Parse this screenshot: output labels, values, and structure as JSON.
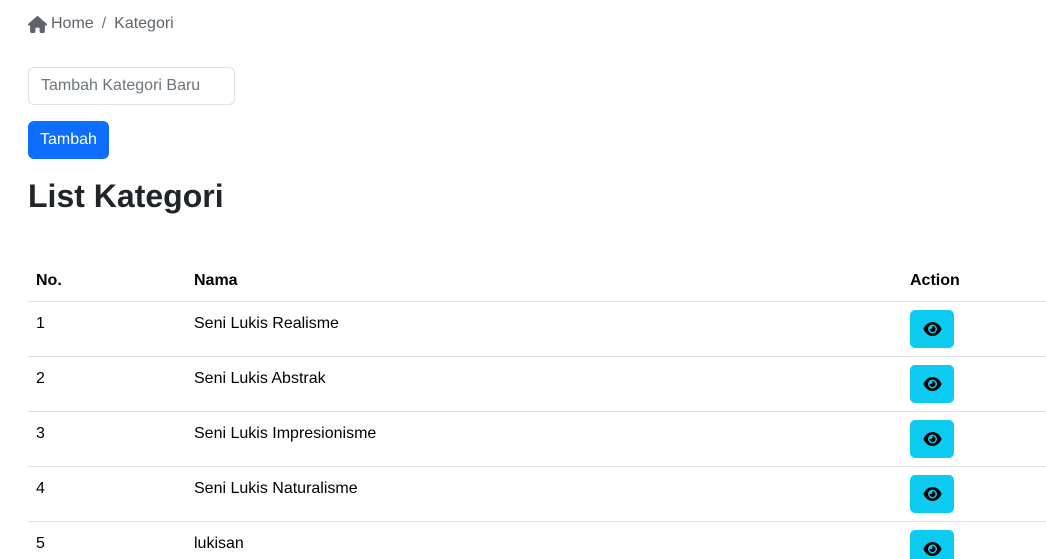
{
  "breadcrumb": {
    "home": "Home",
    "separator": "/",
    "current": "Kategori"
  },
  "form": {
    "input_placeholder": "Tambah Kategori Baru",
    "input_value": "",
    "add_button": "Tambah"
  },
  "page_title": "List Kategori",
  "table": {
    "headers": {
      "no": "No.",
      "name": "Nama",
      "action": "Action"
    },
    "rows": [
      {
        "no": "1",
        "name": "Seni Lukis Realisme"
      },
      {
        "no": "2",
        "name": "Seni Lukis Abstrak"
      },
      {
        "no": "3",
        "name": "Seni Lukis Impresionisme"
      },
      {
        "no": "4",
        "name": "Seni Lukis Naturalisme"
      },
      {
        "no": "5",
        "name": "lukisan"
      }
    ]
  },
  "icons": {
    "home": "home-icon",
    "view": "eye-icon"
  },
  "colors": {
    "primary": "#0d6efd",
    "info": "#0dcaf0",
    "text": "#212529",
    "muted": "#6c757d",
    "border": "#dee2e6"
  }
}
